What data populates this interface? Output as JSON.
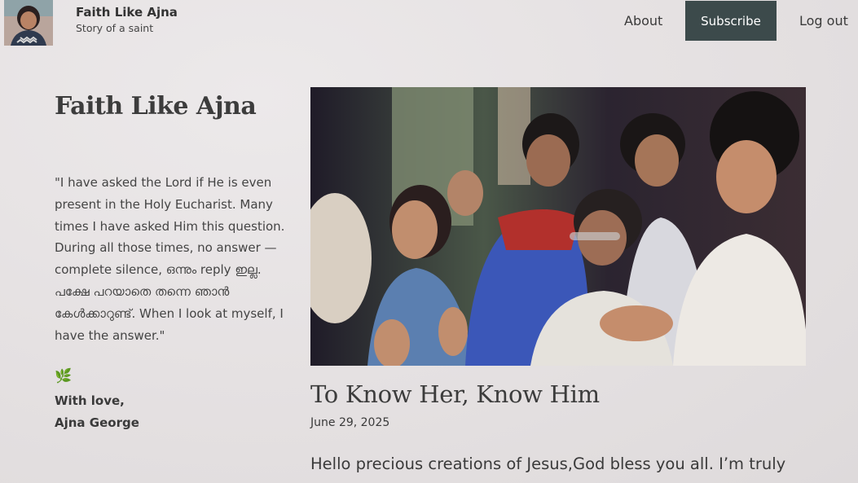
{
  "header": {
    "site_name": "Faith Like Ajna",
    "tagline": "Story of a saint",
    "nav": {
      "about": "About",
      "subscribe": "Subscribe",
      "logout": "Log out"
    },
    "avatar_icon": "avatar-photo"
  },
  "sidebar": {
    "title": "Faith Like Ajna",
    "quote": "\"I have asked the Lord if He is even present in the Holy Eucharist. Many times I have asked Him this question. During all those times, no answer — complete silence, ഒന്നും reply ഇല്ല. പക്ഷേ പറയാതെ തന്നെ ഞാൻ കേൾക്കാറുണ്ട്. When I look at myself, I have the answer.\"",
    "leaf_icon": "🌿",
    "signoff_line1": "With love,",
    "signoff_line2": "Ajna George"
  },
  "post": {
    "hero_image": "crowd-photo",
    "title": "To Know Her, Know Him",
    "date": "June 29, 2025",
    "intro": "Hello precious creations of Jesus,God bless you all. I’m truly"
  },
  "colors": {
    "subscribe_bg": "#3c4a4b",
    "text": "#3a3a3a"
  }
}
